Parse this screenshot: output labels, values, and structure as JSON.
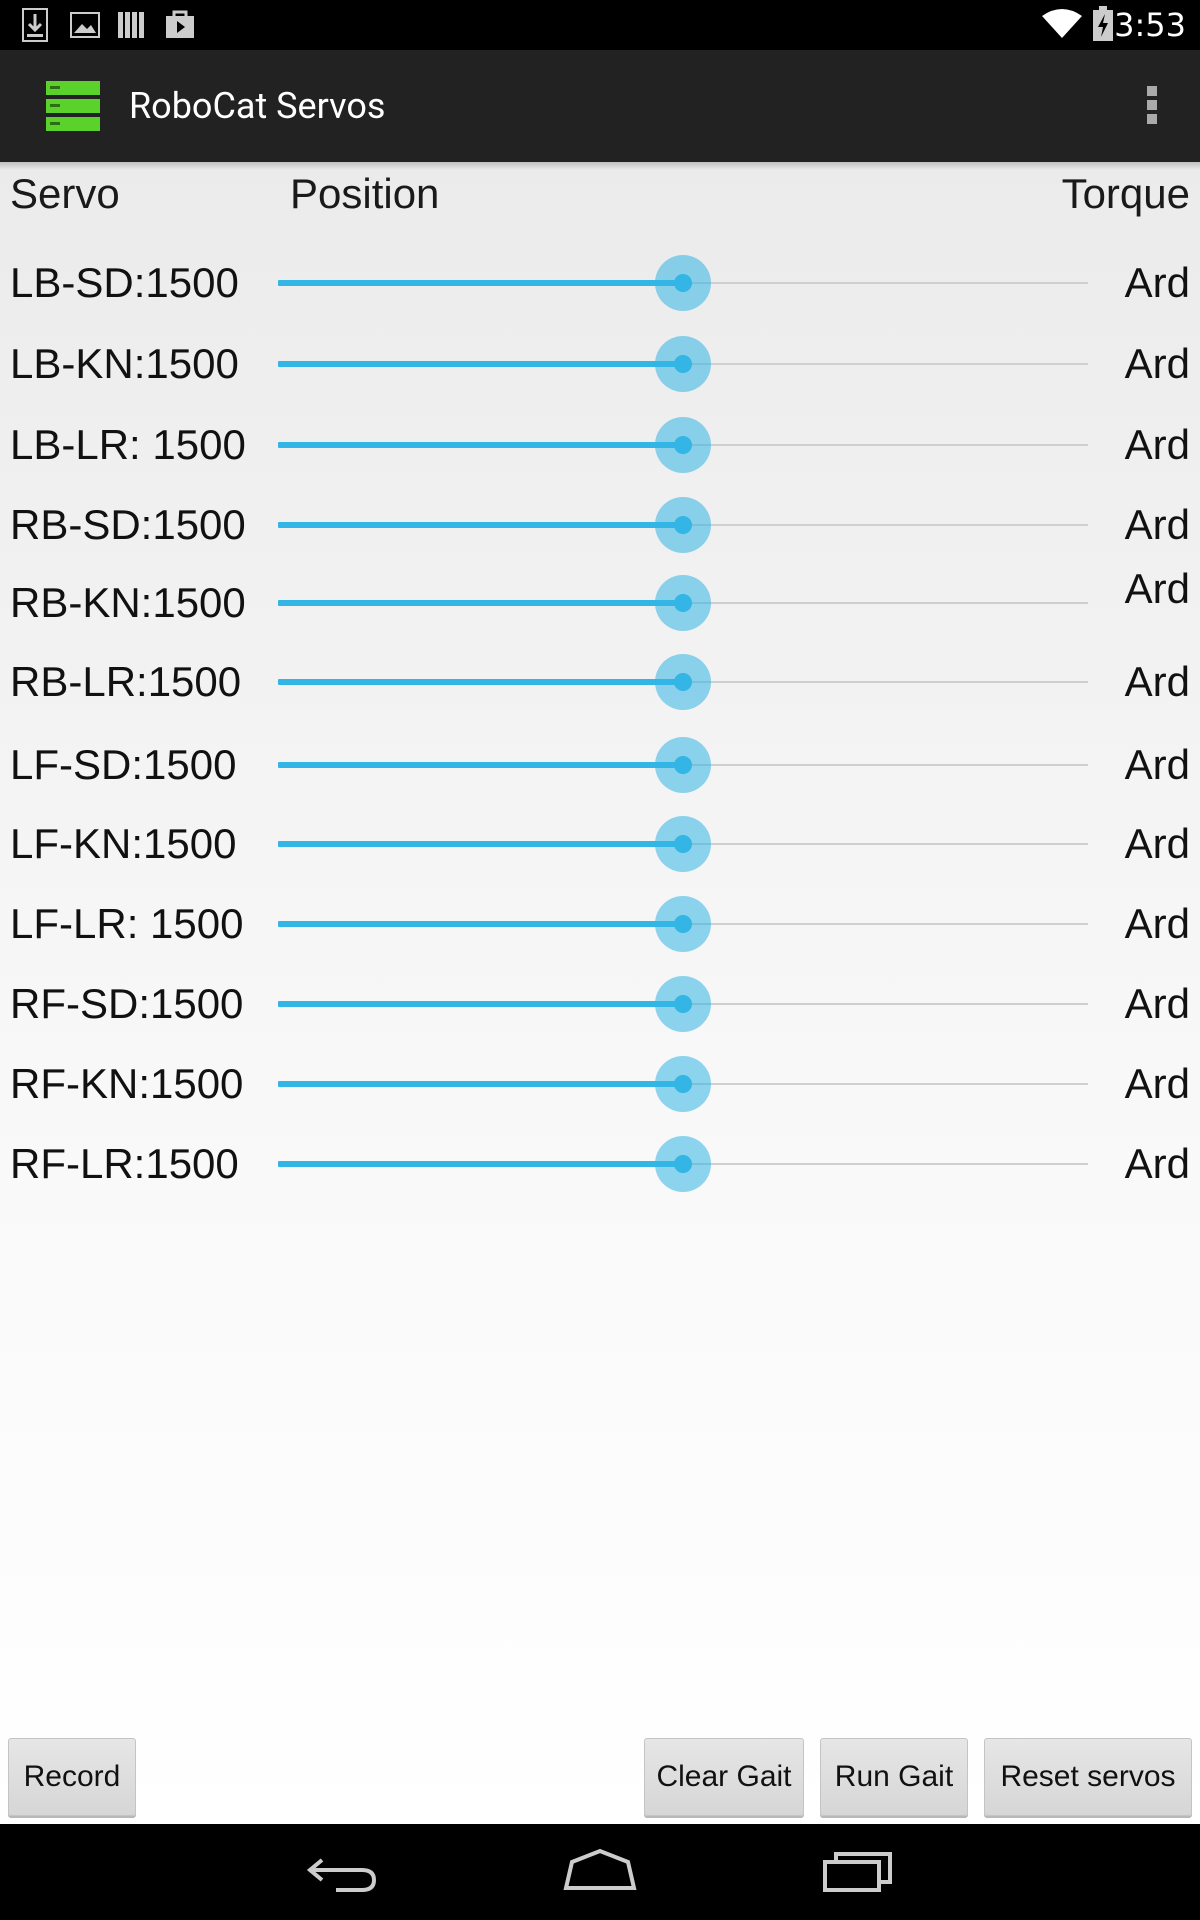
{
  "status_bar": {
    "time": "3:53",
    "left_icons": [
      "download-icon",
      "image-icon",
      "library-icon",
      "shop-icon"
    ],
    "right_icons": [
      "wifi-icon",
      "battery-charging-icon"
    ]
  },
  "app_bar": {
    "title": "RoboCat Servos",
    "logo_icon": "server-stack-icon",
    "logo_color": "#5bd12b",
    "menu_icon": "overflow-menu-icon"
  },
  "headers": {
    "servo": "Servo",
    "position": "Position",
    "torque": "Torque"
  },
  "servos": [
    {
      "label": "LB-SD:1500",
      "value": 0.5,
      "torque": "Ard"
    },
    {
      "label": "LB-KN:1500",
      "value": 0.5,
      "torque": "Ard"
    },
    {
      "label": "LB-LR: 1500",
      "value": 0.5,
      "torque": "Ard"
    },
    {
      "label": "RB-SD:1500",
      "value": 0.5,
      "torque": "Ard"
    },
    {
      "label": "RB-KN:1500",
      "value": 0.5,
      "torque": "Ard"
    },
    {
      "label": "RB-LR:1500",
      "value": 0.5,
      "torque": "Ard"
    },
    {
      "label": "LF-SD:1500",
      "value": 0.5,
      "torque": "Ard"
    },
    {
      "label": "LF-KN:1500",
      "value": 0.5,
      "torque": "Ard"
    },
    {
      "label": "LF-LR: 1500",
      "value": 0.5,
      "torque": "Ard"
    },
    {
      "label": "RF-SD:1500",
      "value": 0.5,
      "torque": "Ard"
    },
    {
      "label": "RF-KN:1500",
      "value": 0.5,
      "torque": "Ard"
    },
    {
      "label": "RF-LR:1500",
      "value": 0.5,
      "torque": "Ard"
    }
  ],
  "buttons": {
    "record": "Record",
    "clear_gait": "Clear Gait",
    "run_gait": "Run Gait",
    "reset_servos": "Reset servos"
  },
  "nav_bar": {
    "back_icon": "back-icon",
    "home_icon": "home-icon",
    "recents_icon": "recent-apps-icon"
  },
  "colors": {
    "accent": "#33b5e5",
    "action_bar": "#222222"
  }
}
